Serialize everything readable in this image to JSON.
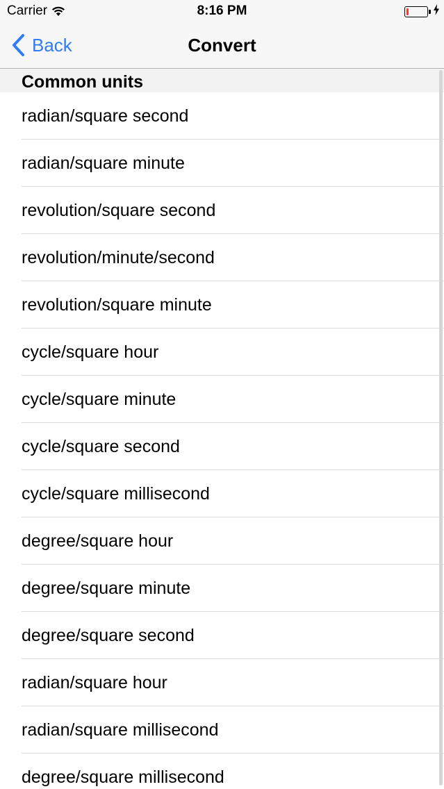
{
  "status_bar": {
    "carrier": "Carrier",
    "time": "8:16 PM",
    "battery_level": 0.1,
    "battery_color": "#ff3b30"
  },
  "nav": {
    "back_label": "Back",
    "title": "Convert",
    "accent_color": "#2f7cf6"
  },
  "list": {
    "section_header": "Common units",
    "items": [
      {
        "label": "radian/square second"
      },
      {
        "label": "radian/square minute"
      },
      {
        "label": "revolution/square second"
      },
      {
        "label": "revolution/minute/second"
      },
      {
        "label": "revolution/square minute"
      },
      {
        "label": "cycle/square hour"
      },
      {
        "label": "cycle/square minute"
      },
      {
        "label": "cycle/square second"
      },
      {
        "label": "cycle/square millisecond"
      },
      {
        "label": "degree/square hour"
      },
      {
        "label": "degree/square minute"
      },
      {
        "label": "degree/square second"
      },
      {
        "label": "radian/square hour"
      },
      {
        "label": "radian/square millisecond"
      },
      {
        "label": "degree/square millisecond"
      }
    ]
  },
  "icons": {
    "wifi": "wifi-icon",
    "battery": "battery-icon",
    "charging": "charging-bolt-icon",
    "back_chevron": "chevron-left-icon"
  }
}
